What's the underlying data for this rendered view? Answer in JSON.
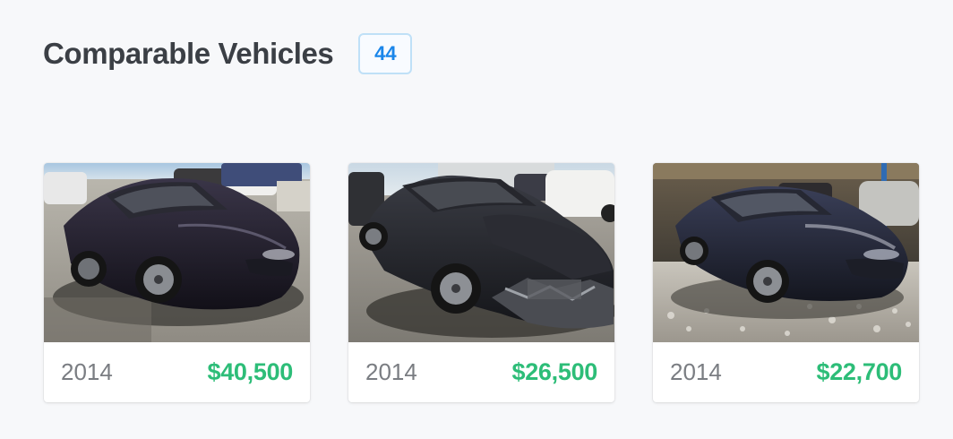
{
  "header": {
    "title": "Comparable Vehicles",
    "count": "44"
  },
  "colors": {
    "accent": "#1a86ea",
    "price": "#2dbd78",
    "background": "#f7f8fa"
  },
  "vehicles": [
    {
      "year": "2014",
      "price": "$40,500",
      "photo": "car-photo-intact"
    },
    {
      "year": "2014",
      "price": "$26,500",
      "photo": "car-photo-front-damage"
    },
    {
      "year": "2014",
      "price": "$22,700",
      "photo": "car-photo-gravel-lot"
    }
  ]
}
